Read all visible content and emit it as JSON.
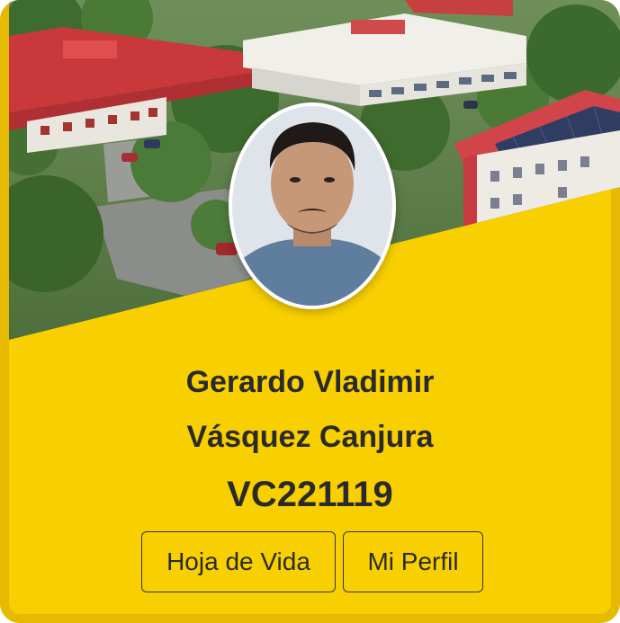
{
  "banner": {
    "alt": "Aerial view of university campus buildings"
  },
  "profile": {
    "photo_alt": "Student profile photo",
    "first_line": "Gerardo Vladimir",
    "second_line": "Vásquez Canjura",
    "student_id": "VC221119"
  },
  "actions": {
    "cv_label": "Hoja de Vida",
    "profile_label": "Mi Perfil"
  },
  "colors": {
    "card_background": "#f8cf00",
    "text": "#2a2a2a",
    "roof_red": "#d23a3f"
  }
}
